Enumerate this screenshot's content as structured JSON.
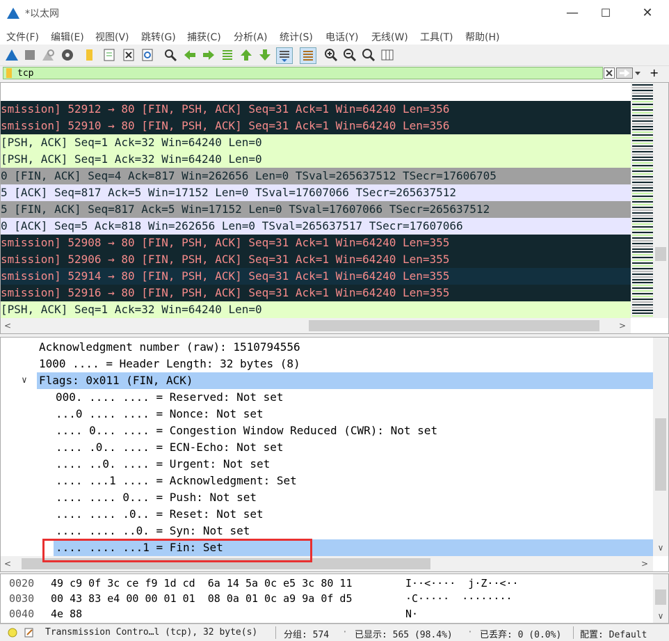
{
  "window": {
    "title": "*以太网",
    "minimize": "—",
    "maximize": "☐",
    "close": "✕"
  },
  "menu": [
    "文件(F)",
    "编辑(E)",
    "视图(V)",
    "跳转(G)",
    "捕获(C)",
    "分析(A)",
    "统计(S)",
    "电话(Y)",
    "无线(W)",
    "工具(T)",
    "帮助(H)"
  ],
  "filter": {
    "value": "tcp"
  },
  "packets": [
    {
      "text": "smission] 52912 → 80 [FIN, PSH, ACK] Seq=31 Ack=1 Win=64240 Len=356",
      "bg": "#12272e",
      "fg": "#f78b8b"
    },
    {
      "text": "smission] 52910 → 80 [FIN, PSH, ACK] Seq=31 Ack=1 Win=64240 Len=356",
      "bg": "#12272e",
      "fg": "#f78b8b"
    },
    {
      "text": "[PSH, ACK] Seq=1 Ack=32 Win=64240 Len=0",
      "bg": "#e4ffc7",
      "fg": "#12272e"
    },
    {
      "text": "[PSH, ACK] Seq=1 Ack=32 Win=64240 Len=0",
      "bg": "#e4ffc7",
      "fg": "#12272e"
    },
    {
      "text": "0 [FIN, ACK] Seq=4 Ack=817 Win=262656 Len=0 TSval=265637512 TSecr=17606705",
      "bg": "#a0a0a0",
      "fg": "#12272e"
    },
    {
      "text": "5 [ACK] Seq=817 Ack=5 Win=17152 Len=0 TSval=17607066 TSecr=265637512",
      "bg": "#e7e6ff",
      "fg": "#12272e"
    },
    {
      "text": "5 [FIN, ACK] Seq=817 Ack=5 Win=17152 Len=0 TSval=17607066 TSecr=265637512",
      "bg": "#a0a0a0",
      "fg": "#12272e"
    },
    {
      "text": "0 [ACK] Seq=5 Ack=818 Win=262656 Len=0 TSval=265637517 TSecr=17607066",
      "bg": "#e7e6ff",
      "fg": "#12272e"
    },
    {
      "text": "smission] 52908 → 80 [FIN, PSH, ACK] Seq=31 Ack=1 Win=64240 Len=355",
      "bg": "#12272e",
      "fg": "#f78b8b"
    },
    {
      "text": "smission] 52906 → 80 [FIN, PSH, ACK] Seq=31 Ack=1 Win=64240 Len=355",
      "bg": "#12272e",
      "fg": "#f78b8b"
    },
    {
      "text": "smission] 52914 → 80 [FIN, PSH, ACK] Seq=31 Ack=1 Win=64240 Len=355",
      "bg": "#12303f",
      "fg": "#f78b8b"
    },
    {
      "text": "smission] 52916 → 80 [FIN, PSH, ACK] Seq=31 Ack=1 Win=64240 Len=355",
      "bg": "#12272e",
      "fg": "#f78b8b"
    },
    {
      "text": "[PSH, ACK] Seq=1 Ack=32 Win=64240 Len=0",
      "bg": "#e4ffc7",
      "fg": "#12272e"
    }
  ],
  "details": [
    {
      "text": "Acknowledgment number (raw): 1510794556",
      "indent": 1,
      "selected": false
    },
    {
      "text": "1000 .... = Header Length: 32 bytes (8)",
      "indent": 1,
      "selected": false
    },
    {
      "text": "Flags: 0x011 (FIN, ACK)",
      "indent": 1,
      "selected": true,
      "expanded": true
    },
    {
      "text": "000. .... .... = Reserved: Not set",
      "indent": 2,
      "selected": false
    },
    {
      "text": "...0 .... .... = Nonce: Not set",
      "indent": 2,
      "selected": false
    },
    {
      "text": ".... 0... .... = Congestion Window Reduced (CWR): Not set",
      "indent": 2,
      "selected": false
    },
    {
      "text": ".... .0.. .... = ECN-Echo: Not set",
      "indent": 2,
      "selected": false
    },
    {
      "text": ".... ..0. .... = Urgent: Not set",
      "indent": 2,
      "selected": false
    },
    {
      "text": ".... ...1 .... = Acknowledgment: Set",
      "indent": 2,
      "selected": false
    },
    {
      "text": ".... .... 0... = Push: Not set",
      "indent": 2,
      "selected": false
    },
    {
      "text": ".... .... .0.. = Reset: Not set",
      "indent": 2,
      "selected": false
    },
    {
      "text": ".... .... ..0. = Syn: Not set",
      "indent": 2,
      "selected": false
    },
    {
      "text": ".... .... ...1 = Fin: Set",
      "indent": 2,
      "selected": true
    }
  ],
  "bytes": [
    {
      "offset": "0020",
      "hex": "49 c9 0f 3c ce f9 1d cd  6a 14 5a 0c e5 3c 80 11",
      "ascii": "I··<····  j·Z··<··"
    },
    {
      "offset": "0030",
      "hex": "00 43 83 e4 00 00 01 01  08 0a 01 0c a9 9a 0f d5",
      "ascii": "·C·····  ········"
    },
    {
      "offset": "0040",
      "hex": "4e 88",
      "ascii": "N·"
    }
  ],
  "status": {
    "field": "Transmission Contro…l (tcp), 32 byte(s)",
    "packets": "分组: 574",
    "displayed": "已显示: 565 (98.4%)",
    "dropped": "已丢弃: 0 (0.0%)",
    "profile": "配置: Default"
  },
  "colors": {
    "selection": "#a8cdf7",
    "highlight_box": "#e83030",
    "filter_bg": "#c8f5b4"
  }
}
